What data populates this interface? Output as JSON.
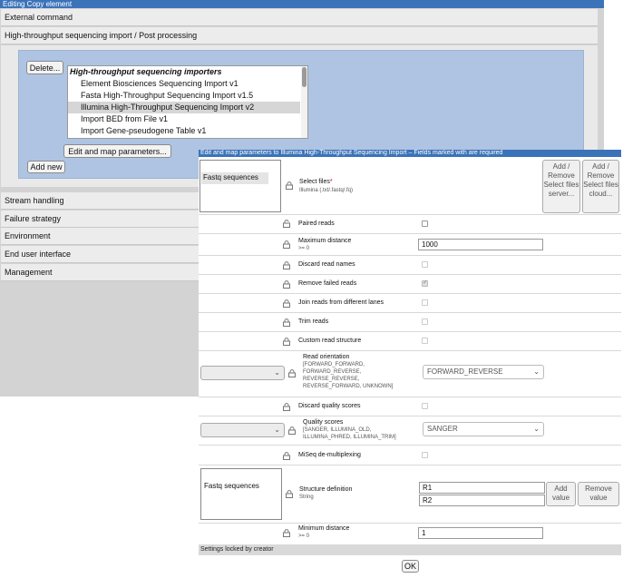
{
  "background_window": {
    "title": "Editing Copy element",
    "sections": {
      "external_command": "External command",
      "hts_import": "High-throughput sequencing import / Post processing",
      "stream_handling": "Stream handling",
      "failure_strategy": "Failure strategy",
      "environment": "Environment",
      "end_user_interface": "End user interface",
      "management": "Management"
    },
    "delete_label": "Delete...",
    "importers": {
      "group": "High-throughput sequencing importers",
      "items": [
        "Element Biosciences Sequencing Import v1",
        "Fasta High-Throughput Sequencing Import v1.5",
        "Illumina High-Throughput Sequencing Import v2",
        "Import BED from File v1",
        "Import Gene-pseudogene Table v1"
      ],
      "selected_index": 2
    },
    "edit_map_label": "Edit and map parameters...",
    "add_new_label": "Add new"
  },
  "dialog": {
    "title": "Edit and map parameters to Illumina High-Throughput Sequencing Import – Fields marked with   are required",
    "input_panel": {
      "item": "Fastq sequences"
    },
    "select_files": {
      "label": "Select files",
      "required_mark": "*",
      "sub": "Illumina (.txt/.fastq/.fq)",
      "server_button": "Add / Remove Select files server...",
      "cloud_button": "Add / Remove Select files cloud..."
    },
    "paired_reads": {
      "label": "Paired reads",
      "checked": false
    },
    "maximum_distance": {
      "label": "Maximum distance",
      "sub": ">= 0",
      "value": "1000"
    },
    "discard_read_names": {
      "label": "Discard read names",
      "checked": false
    },
    "remove_failed_reads": {
      "label": "Remove failed reads",
      "checked": true
    },
    "join_reads": {
      "label": "Join reads from different lanes",
      "checked": false
    },
    "trim_reads": {
      "label": "Trim reads",
      "checked": false
    },
    "custom_read_structure": {
      "label": "Custom read structure",
      "checked": false
    },
    "read_orientation": {
      "label": "Read orientation",
      "sub_lines": [
        "[FORWARD_FORWARD,",
        "FORWARD_REVERSE,",
        "REVERSE_REVERSE,",
        "REVERSE_FORWARD, UNKNOWN]"
      ],
      "value": "FORWARD_REVERSE"
    },
    "discard_quality_scores": {
      "label": "Discard quality scores",
      "checked": false
    },
    "quality_scores": {
      "label": "Quality scores",
      "sub_lines": [
        "[SANGER, ILLUMINA_OLD,",
        "ILLUMINA_PHRED, ILLUMINA_TRIM]"
      ],
      "value": "SANGER"
    },
    "miseq_demultiplexing": {
      "label": "MiSeq de-multiplexing",
      "checked": false
    },
    "structure_definition": {
      "panel_item": "Fastq sequences",
      "label": "Structure definition",
      "sub": "String",
      "values": [
        "R1",
        "R2"
      ],
      "add_button": "Add value",
      "remove_button": "Remove value"
    },
    "minimum_distance": {
      "label": "Minimum distance",
      "sub": ">= 0",
      "value": "1"
    },
    "footer": "Settings locked by creator",
    "ok_label": "OK"
  }
}
